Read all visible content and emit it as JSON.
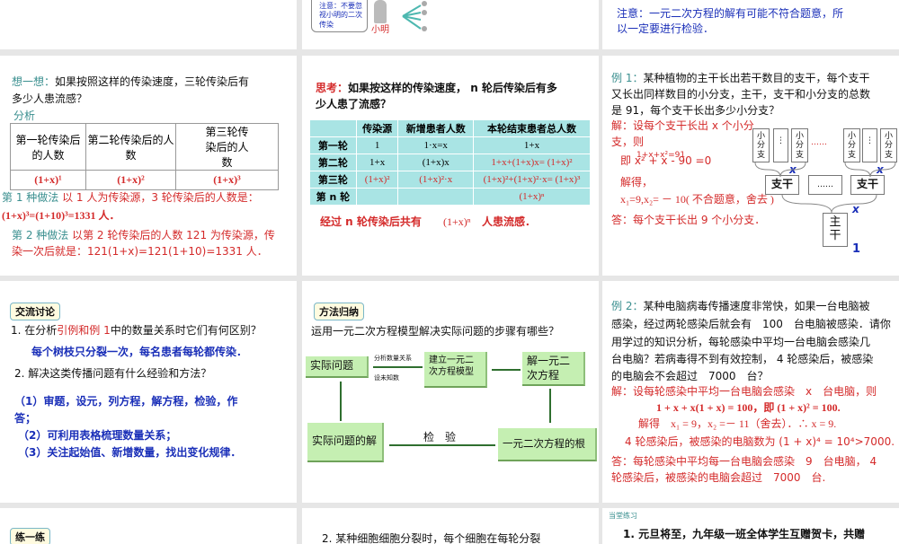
{
  "s1": {},
  "s2": {
    "callout": "注意：不要忽视小明的二次传染",
    "name": "小明"
  },
  "s3": {
    "note1": "注意：一元二次方程的解有可能不符合题意，所",
    "note2": "以一定要进行检验．"
  },
  "s4": {
    "think_label": "想一想：",
    "think1": "如果按照这样的传染速度，三轮传染后有",
    "think2": "多少人患流感？",
    "analysis": "分析",
    "headers": [
      "第一轮传染后的人数",
      "第二轮传染后的人数",
      "第三轮传染后的人数"
    ],
    "values": [
      "(1+x)¹",
      "(1+x)²",
      "(1+x)³"
    ],
    "m1_label": "第 1 种做法",
    "m1_text": "以 1 人为传染源，3 轮传染后的人数是：",
    "m1_line2": "(1+x)³=(1+10)³=1331 人．",
    "m2_label": "第 2 种做法",
    "m2_text": "以第 2 轮传染后的人数 121 为传染源，传",
    "m2_line2": "染一次后就是：121(1+x)=121(1+10)=1331 人．"
  },
  "s5": {
    "label": "思考：",
    "q1": "如果按这样的传染速度， n 轮后传染后有多",
    "q2": "少人患了流感？",
    "headers": [
      "",
      "传染源",
      "新增患者人数",
      "本轮结束患者总人数"
    ],
    "rows": [
      [
        "第一轮",
        "1",
        "1·x=x",
        "1+x"
      ],
      [
        "第二轮",
        "1+x",
        "(1+x)x",
        "1+x+(1+x)x= (1+x)²"
      ],
      [
        "第三轮",
        "(1+x)²",
        "(1+x)²·x",
        "(1+x)²+(1+x)²·x= (1+x)³"
      ],
      [
        "第 n 轮",
        "",
        "",
        "(1+x)ⁿ"
      ]
    ],
    "concl_a": "经过 n 轮传染后共有",
    "concl_b": "(1+x)ⁿ",
    "concl_c": "人患流感．"
  },
  "s6": {
    "label": "例 1：",
    "q1": "某种植物的主干长出若干数目的支干，每个支干",
    "q2": "又长出同样数目的小分支，主干，支干和小分支的总数",
    "q3": "是 91，每个支干长出多少小分支？",
    "sol1": "解：设每个支干长出 x 个小分",
    "sol2": "支，则",
    "sol_eq0": "1+x+x²=91",
    "sol_eq": "即 x² + x - 90 =0",
    "sol3": "解得，",
    "sol4": "x₁=9,x₂= － 10( 不合题意，舍去 )",
    "ans": "答：每个支干长出 9 个小分支．",
    "small": "小分支",
    "dots": "……",
    "var": "x",
    "branch": "支干",
    "trunk": "主干",
    "one": "1"
  },
  "s7": {
    "badge": "交流讨论",
    "q1a": "1. 在分析",
    "q1b": "引例和例 1",
    "q1c": "中的数量关系时它们有何区别？",
    "a1": "每个树枝只分裂一次，每名患者每轮都传染．",
    "q2": "2. 解决这类传播问题有什么经验和方法？",
    "a2_1": "（1）审题，设元，列方程，解方程，检验，作",
    "a2_1b": "答；",
    "a2_2": "（2）可利用表格梳理数量关系；",
    "a2_3": "（3）关注起始值、新增数量，找出变化规律．"
  },
  "s8": {
    "badge": "方法归纳",
    "q": "运用一元二次方程模型解决实际问题的步骤有哪些？",
    "b1": "实际问题",
    "l1": "分析数量关系",
    "l2": "设未知数",
    "b2": "建立一元二次方程模型",
    "b3": "解一元二次方程",
    "b4": "一元二次方程的根",
    "l3": "检　验",
    "b5": "实际问题的解"
  },
  "s9": {
    "label": "例 2：",
    "p1": "某种电脑病毒传播速度非常快，如果一台电脑被",
    "p2": "感染，经过两轮感染后就会有　100　台电脑被感染．请你",
    "p3": "用学过的知识分析，每轮感染中平均一台电脑会感染几",
    "p4": "台电脑？若病毒得不到有效控制， 4 轮感染后，被感染",
    "p5": "的电脑会不会超过　7000　台？",
    "s1": "解：设每轮感染中平均一台电脑会感染　x　台电脑，则",
    "s2": "1 + x + x(1 + x) = 100，即 (1 + x)² = 100.",
    "s3": "解得　x₁ = 9，x₂ =－ 11（舍去）．∴ x = 9.",
    "s4": "4 轮感染后，被感染的电脑数为 (1 + x)⁴ = 10⁴>7000.",
    "s5": "答：每轮感染中平均每一台电脑会感染　9　台电脑， 4",
    "s6": "轮感染后，被感染的电脑会超过　7000　台."
  },
  "s10": {
    "badge": "练一练"
  },
  "s11": {
    "text": "2. 某种细胞细胞分裂时，每个细胞在每轮分裂"
  },
  "s12": {
    "title": "当堂练习",
    "text": "1. 元旦将至，九年级一班全体学生互赠贺卡，共赠"
  }
}
